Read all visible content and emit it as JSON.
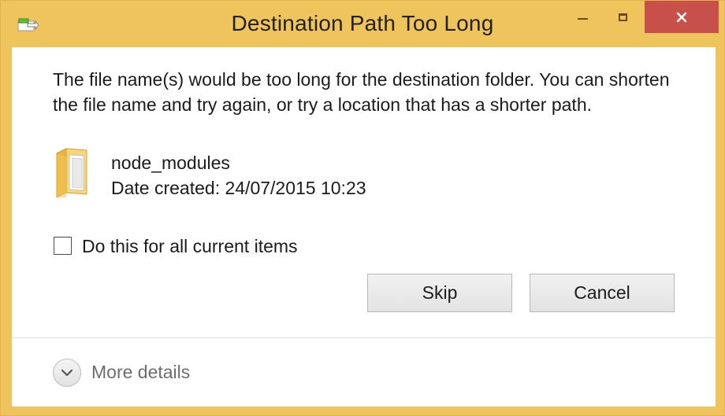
{
  "window": {
    "title": "Destination Path Too Long",
    "app_icon": "file-move-icon",
    "controls": {
      "minimize": "minimize-icon",
      "maximize": "maximize-icon",
      "close": "close-icon"
    }
  },
  "message": "The file name(s) would be too long for the destination folder. You can shorten the file name and try again, or try a location that has a shorter path.",
  "item": {
    "icon": "folder-icon",
    "name": "node_modules",
    "date_created": "Date created: 24/07/2015 10:23"
  },
  "option": {
    "label": "Do this for all current items",
    "checked": false
  },
  "buttons": {
    "skip": "Skip",
    "cancel": "Cancel"
  },
  "footer": {
    "more_details": "More details",
    "icon": "chevron-down-icon"
  },
  "colors": {
    "frame": "#f0c45d",
    "close_button": "#c7504b"
  }
}
